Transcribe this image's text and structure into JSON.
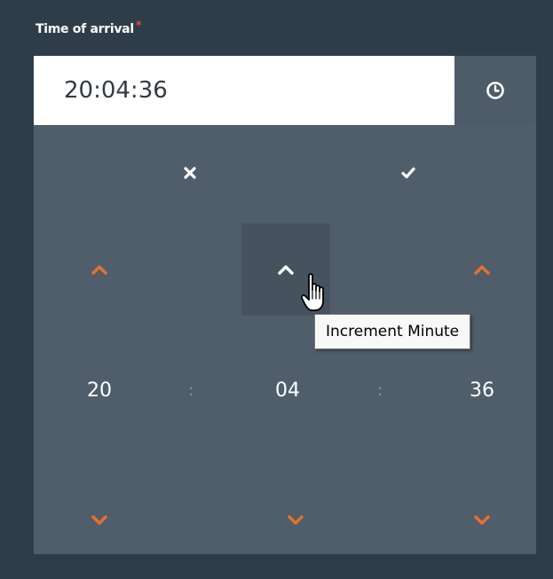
{
  "field": {
    "label": "Time of arrival",
    "required_marker": "*",
    "value": "20:04:36"
  },
  "picker": {
    "close_icon": "close-icon",
    "confirm_icon": "check-icon",
    "hours": "20",
    "minutes": "04",
    "seconds": "36",
    "separator": ":"
  },
  "tooltip": {
    "text": "Increment Minute"
  },
  "colors": {
    "background": "#2f3d4b",
    "panel": "#505e6c",
    "accent": "#e8712a",
    "required": "#e0483a"
  }
}
